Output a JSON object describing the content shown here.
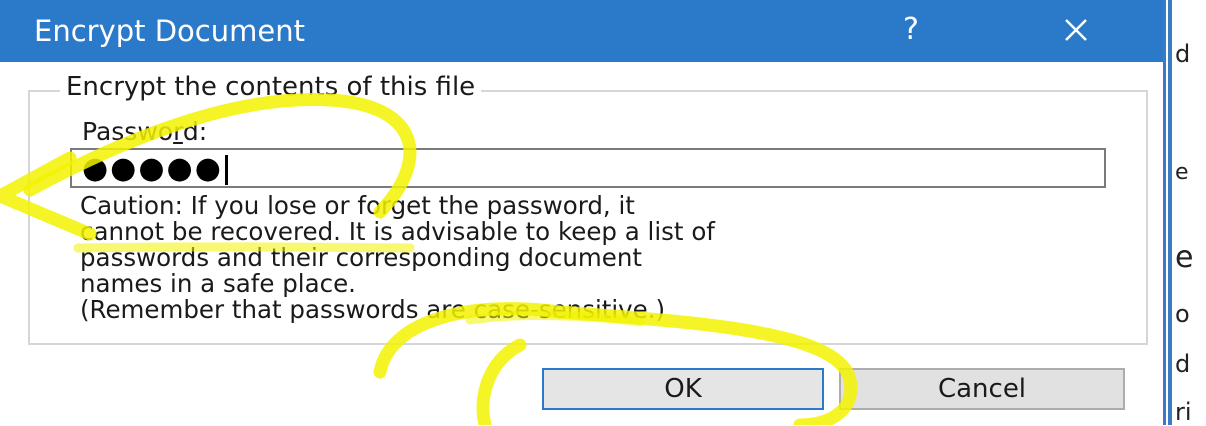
{
  "dialog": {
    "title": "Encrypt Document",
    "help_label": "?",
    "group_label": "Encrypt the contents of this file",
    "password_label_before": "Passwo",
    "password_label_accel": "r",
    "password_label_after": "d:",
    "password_value": "●●●●●",
    "caution_lines": [
      "Caution: If you lose or forget the password, it",
      "cannot be recovered. It is advisable to keep a list of",
      "passwords and their corresponding document",
      "names in a safe place.",
      "(Remember that passwords are case-sensitive.)"
    ],
    "ok_label": "OK",
    "cancel_label": "Cancel"
  },
  "background_doc": {
    "fragments": [
      "d",
      "e",
      "e",
      "o",
      "d",
      "ri"
    ]
  },
  "colors": {
    "titlebar": "#2b79c9",
    "highlight": "#f2f200",
    "ok_border": "#2b79c9"
  },
  "icons": {
    "close": "close-icon",
    "help": "help-icon"
  }
}
